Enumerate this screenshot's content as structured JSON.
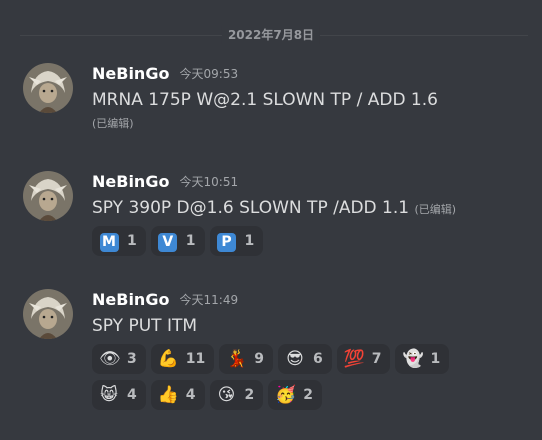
{
  "date_divider": "2022年7月8日",
  "messages": [
    {
      "username": "NeBinGo",
      "timestamp": "今天09:53",
      "content": "MRNA 175P W@2.1 SLOWN TP / ADD 1.6",
      "edited": "(已编辑)",
      "reactions": []
    },
    {
      "username": "NeBinGo",
      "timestamp": "今天10:51",
      "content": "SPY 390P D@1.6 SLOWN TP /ADD 1.1",
      "edited": "(已编辑)",
      "reactions": [
        {
          "emoji": "M",
          "icon": "regional-indicator-m-icon",
          "count": "1"
        },
        {
          "emoji": "V",
          "icon": "regional-indicator-v-icon",
          "count": "1"
        },
        {
          "emoji": "P",
          "icon": "regional-indicator-p-icon",
          "count": "1"
        }
      ]
    },
    {
      "username": "NeBinGo",
      "timestamp": "今天11:49",
      "content": "SPY PUT ITM",
      "reactions": [
        {
          "emoji": "👁",
          "icon": "eye-icon",
          "count": "3"
        },
        {
          "emoji": "💪",
          "icon": "flexed-biceps-icon",
          "count": "11"
        },
        {
          "emoji": "💃",
          "icon": "dancer-icon",
          "count": "9"
        },
        {
          "emoji": "😎",
          "icon": "sunglasses-face-icon",
          "count": "6"
        },
        {
          "emoji": "💯",
          "icon": "hundred-points-icon",
          "count": "7"
        },
        {
          "emoji": "👻",
          "icon": "ghost-icon",
          "count": "1"
        },
        {
          "emoji": "😸",
          "icon": "grinning-cat-icon",
          "count": "4"
        },
        {
          "emoji": "👍",
          "icon": "thumbs-up-icon",
          "count": "4"
        },
        {
          "emoji": "😘",
          "icon": "kissing-face-icon",
          "count": "2"
        },
        {
          "emoji": "🥳",
          "icon": "partying-face-icon",
          "count": "2"
        }
      ]
    }
  ],
  "colors": {
    "background": "#36393f",
    "reaction_bg": "#2f3136",
    "username": "#ffffff",
    "text": "#dcddde",
    "muted": "#a3a6aa",
    "regional_indicator": "#3e88d4"
  }
}
